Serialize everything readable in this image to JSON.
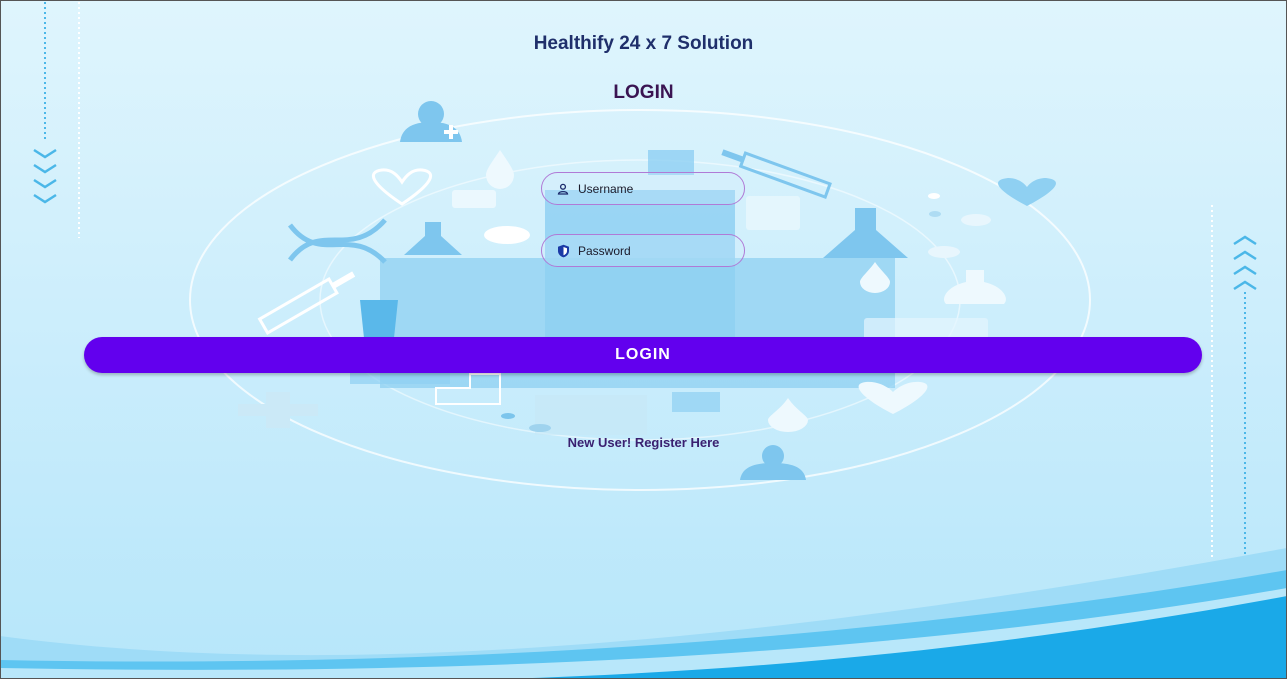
{
  "app": {
    "title": "Healthify 24 x 7 Solution",
    "heading": "LOGIN"
  },
  "form": {
    "username_placeholder": "Username",
    "username_value": "",
    "password_placeholder": "Password",
    "password_value": "",
    "login_label": "LOGIN",
    "register_label": "New User!  Register Here"
  },
  "icons": {
    "username": "user-icon",
    "password": "shield-icon"
  },
  "colors": {
    "primary": "#6200ee",
    "field_border": "#b07ad6",
    "title": "#1f2f6b",
    "heading": "#3a1452",
    "background": "#cdeefc",
    "accent_wave": "#1aa9e8"
  }
}
